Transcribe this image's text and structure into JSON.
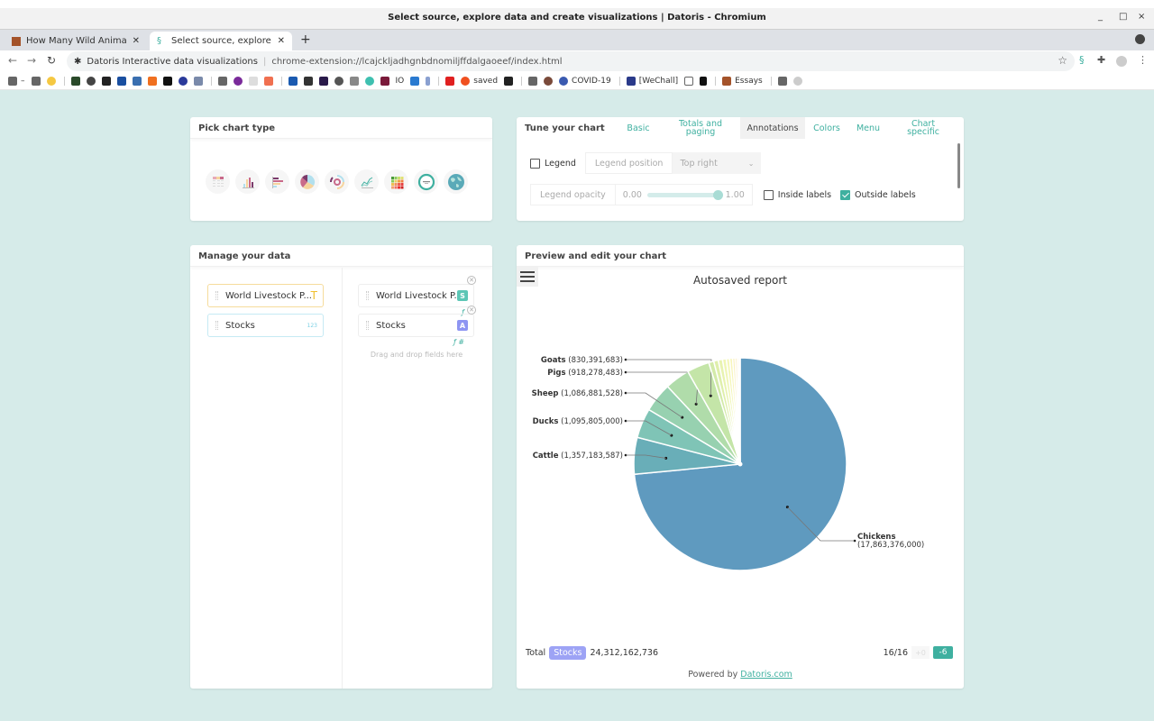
{
  "window": {
    "title": "Select source, explore data and create visualizations | Datoris - Chromium",
    "controls": [
      "_",
      "□",
      "×"
    ]
  },
  "tabs": [
    {
      "label": "How Many Wild Animals Ar",
      "active": false
    },
    {
      "label": "Select source, explore data",
      "active": true
    }
  ],
  "omnibox": {
    "site_name": "Datoris Interactive data visualizations",
    "url": "chrome-extension://lcajckljadhgnbdnomiljffdalgaoeef/index.html"
  },
  "bookmarks": [
    {
      "label": "",
      "icon": "folder-icon"
    },
    {
      "label": "saved",
      "icon": "reddit-icon"
    },
    {
      "label": "COVID-19",
      "icon": "virus-icon"
    },
    {
      "label": "[WeChall]",
      "icon": "wechall-icon"
    },
    {
      "label": "Essays",
      "icon": "essays-icon"
    }
  ],
  "pick_panel": {
    "title": "Pick chart type",
    "chart_types": [
      "table",
      "column",
      "bar",
      "pie",
      "sunburst",
      "line",
      "heatmap",
      "gauge",
      "map"
    ]
  },
  "tune_panel": {
    "title": "Tune your chart",
    "tabs": [
      {
        "label": "Basic",
        "active": false
      },
      {
        "label": "Totals and paging",
        "active": false
      },
      {
        "label": "Annotations",
        "active": true
      },
      {
        "label": "Colors",
        "active": false
      },
      {
        "label": "Menu",
        "active": false
      },
      {
        "label": "Chart specific",
        "active": false
      }
    ],
    "legend_label": "Legend",
    "legend_checked": false,
    "legend_position_label": "Legend position",
    "legend_position_value": "Top right",
    "legend_opacity_label": "Legend opacity",
    "opacity_min": "0.00",
    "opacity_max": "1.00",
    "opacity_value": 1.0,
    "inside_labels_label": "Inside labels",
    "inside_labels_checked": false,
    "outside_labels_label": "Outside labels",
    "outside_labels_checked": true
  },
  "manage_panel": {
    "title": "Manage your data",
    "available_fields": [
      {
        "label": "World Livestock P...",
        "type": "T"
      },
      {
        "label": "Stocks",
        "type": "123"
      }
    ],
    "selected_fields": [
      {
        "label": "World Livestock P...",
        "badge": "S",
        "badge_color": "#5cc6b5"
      },
      {
        "label": "Stocks",
        "badge": "A",
        "badge_color": "#8e95f2"
      }
    ],
    "dropzone_text": "Drag and drop fields here"
  },
  "preview_panel": {
    "title": "Preview and edit your chart",
    "total_label": "Total",
    "total_pill": "Stocks",
    "total_value": "24,312,162,736",
    "page_info": "16/16",
    "plus_btn": "+0",
    "minus_btn": "-6",
    "powered_by": "Powered by",
    "powered_link": "Datoris.com"
  },
  "chart_data": {
    "type": "pie",
    "title": "Autosaved report",
    "total": 24312162736,
    "slice_count": 16,
    "labeled": [
      {
        "label": "Chickens",
        "value": 17863376000,
        "color": "#5f9abf"
      },
      {
        "label": "Cattle",
        "value": 1357183587,
        "color": "#69aeb8"
      },
      {
        "label": "Ducks",
        "value": 1095805000,
        "color": "#7fc4b6"
      },
      {
        "label": "Sheep",
        "value": 1086881528,
        "color": "#97d1b0"
      },
      {
        "label": "Pigs",
        "value": 918278483,
        "color": "#b0dcaa"
      },
      {
        "label": "Goats",
        "value": 830391683,
        "color": "#c4e5a8"
      }
    ],
    "unlabeled_remainder": 1160246455,
    "unlabeled_colors": [
      "#d3eaa9",
      "#dfefab",
      "#e8f3b0",
      "#eff6b4",
      "#f4f7b8",
      "#f7f5ba",
      "#f9f1bd",
      "#fbedc0",
      "#fcebc4",
      "#fde9c8"
    ],
    "outside_labels": true
  }
}
